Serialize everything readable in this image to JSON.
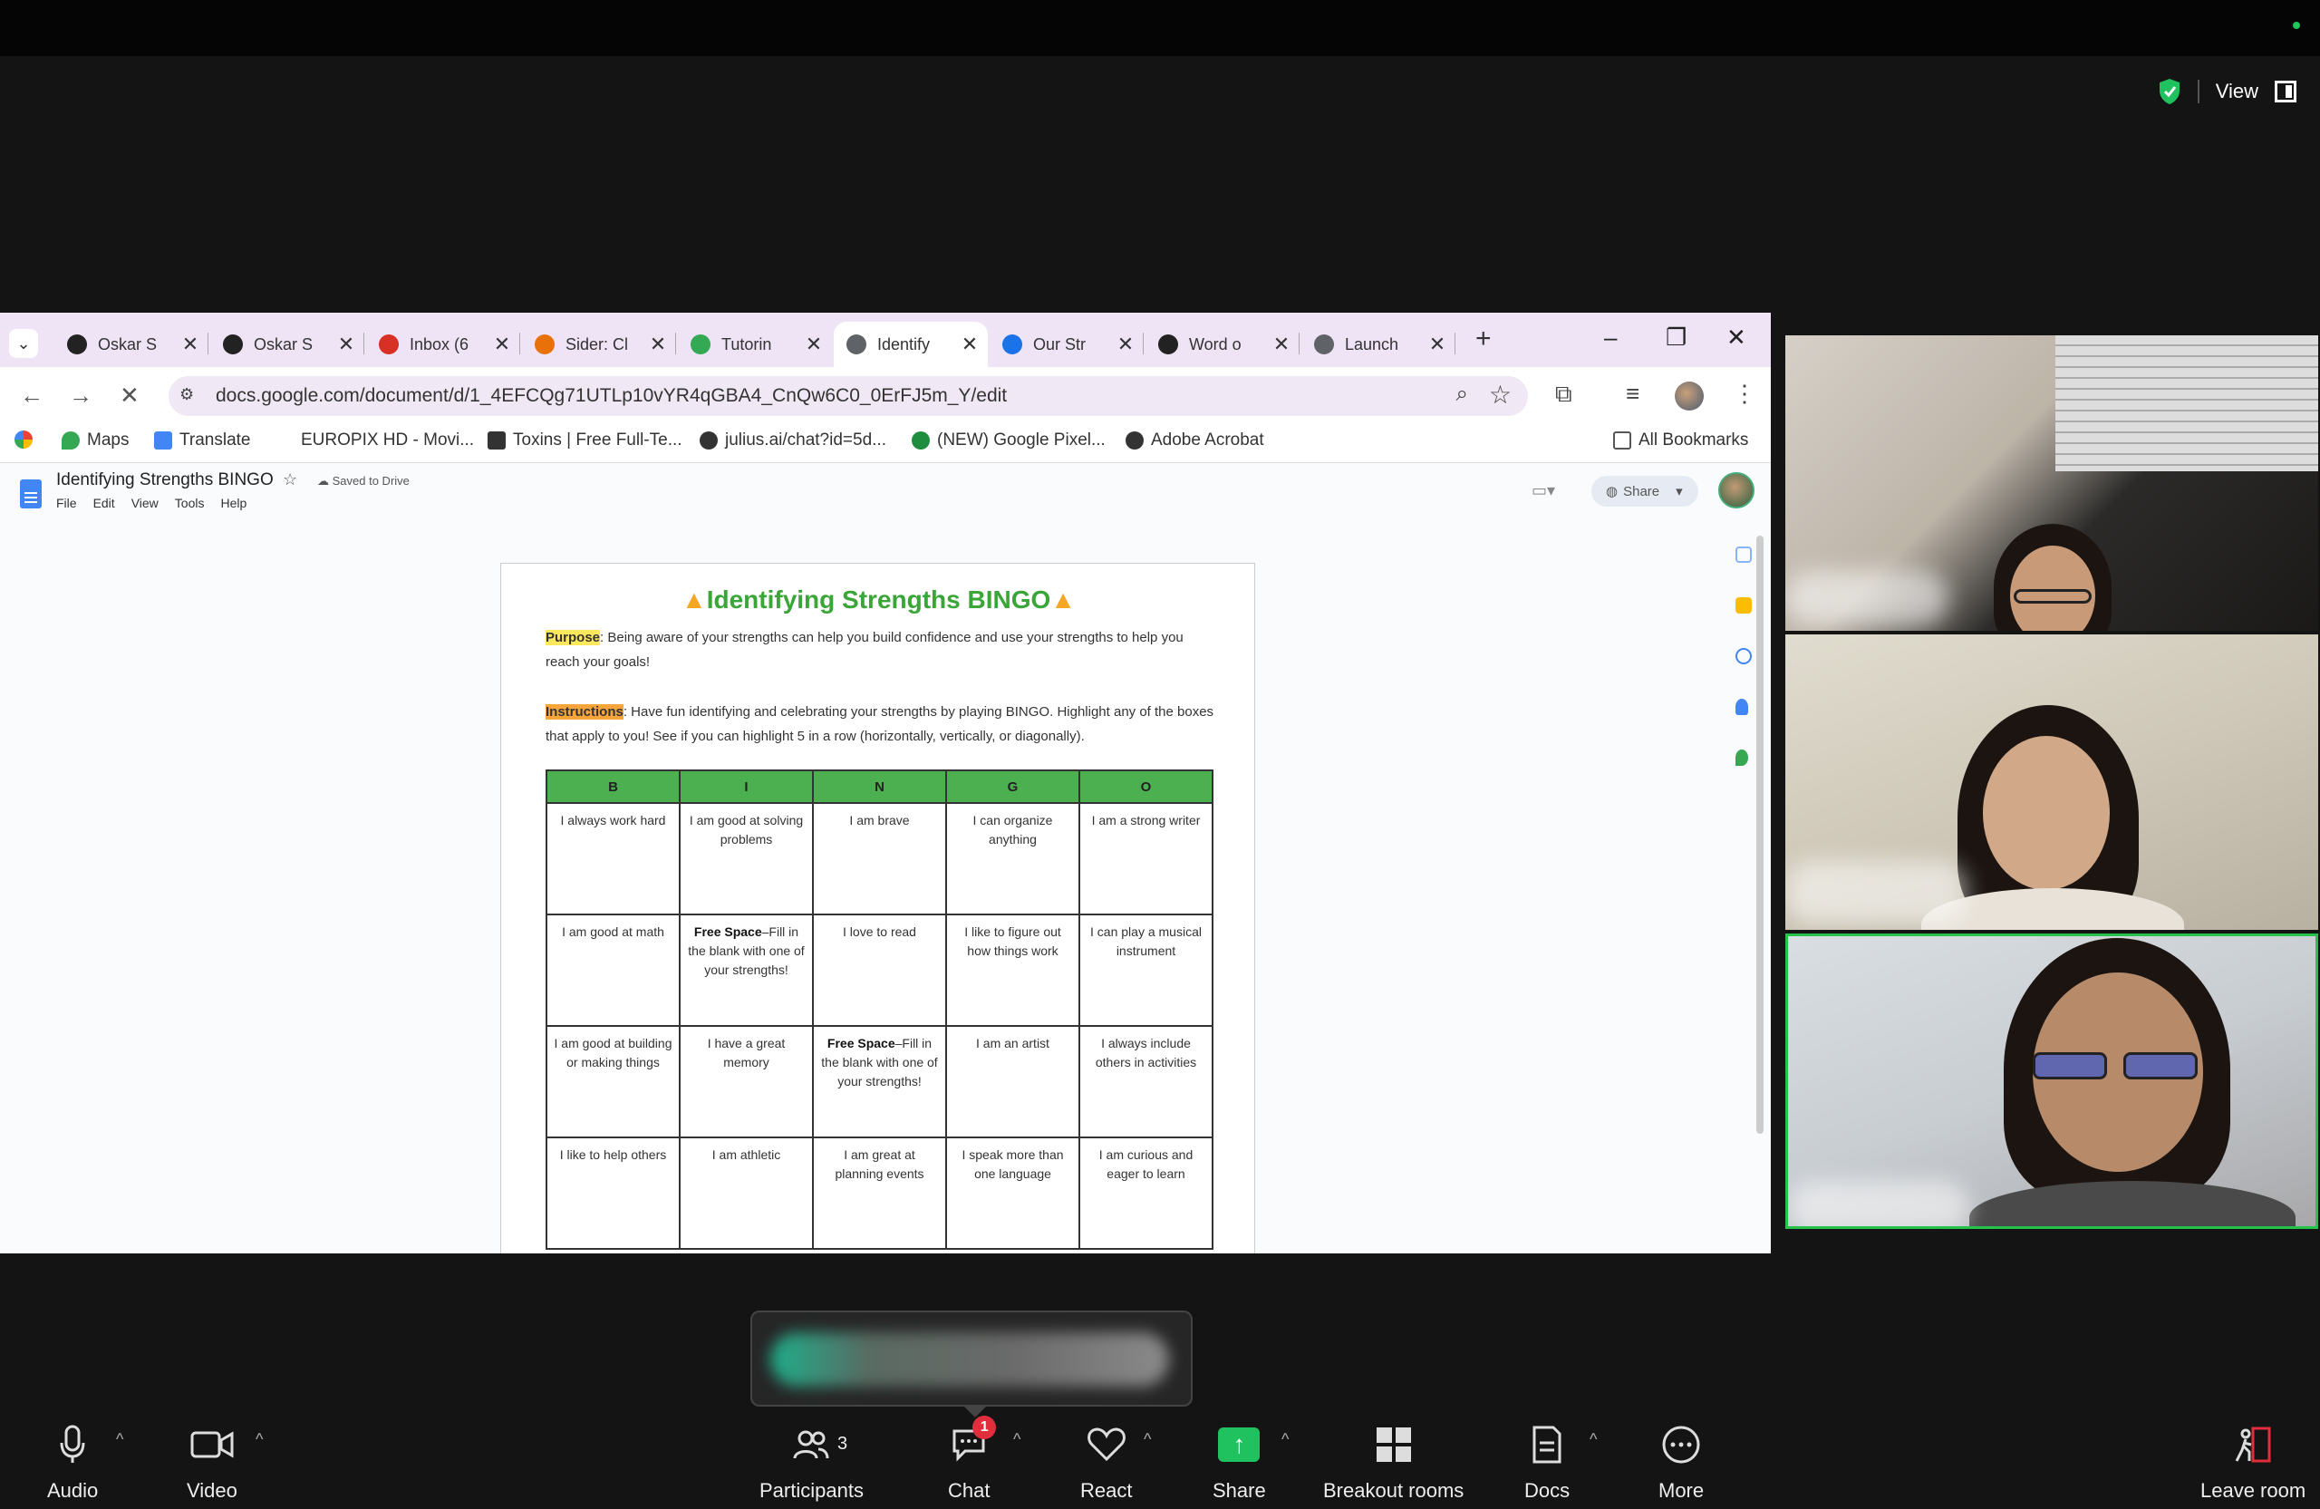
{
  "zoom": {
    "view_label": "View",
    "participants_count": "3",
    "chat_badge": "1",
    "toolbar": {
      "audio": "Audio",
      "video": "Video",
      "participants": "Participants",
      "chat": "Chat",
      "react": "React",
      "share": "Share",
      "breakout": "Breakout rooms",
      "docs": "Docs",
      "more": "More",
      "leave": "Leave room"
    }
  },
  "browser": {
    "tabs": [
      {
        "label": "Oskar S",
        "icon_color": "#222"
      },
      {
        "label": "Oskar S",
        "icon_color": "#222"
      },
      {
        "label": "Inbox (6",
        "icon_color": "#d93025"
      },
      {
        "label": "Sider: Cl",
        "icon_color": "#e8710a"
      },
      {
        "label": "Tutorin",
        "icon_color": "#34a853"
      },
      {
        "label": "Identify",
        "icon_color": "#5f6368"
      },
      {
        "label": "Our Str",
        "icon_color": "#1a73e8"
      },
      {
        "label": "Word o",
        "icon_color": "#222"
      },
      {
        "label": "Launch",
        "icon_color": "#5f6368"
      }
    ],
    "url": "docs.google.com/document/d/1_4EFCQg71UTLp10vYR4qGBA4_CnQw6C0_0ErFJ5m_Y/edit",
    "bookmarks": [
      "Maps",
      "Translate",
      "EUROPIX HD - Movi...",
      "Toxins | Free Full-Te...",
      "julius.ai/chat?id=5d...",
      "(NEW) Google Pixel...",
      "Adobe Acrobat",
      "All Bookmarks"
    ]
  },
  "docs": {
    "title": "Identifying Strengths BINGO",
    "saved": "Saved to Drive",
    "menu": [
      "File",
      "Edit",
      "View",
      "Tools",
      "Help"
    ],
    "share": "Share",
    "page": {
      "heading": "Identifying Strengths BINGO",
      "purpose_label": "Purpose",
      "purpose_text": ": Being aware of your strengths can help you build confidence and use your strengths to help you reach your goals!",
      "instructions_label": "Instructions",
      "instructions_text": ": Have fun identifying and celebrating your strengths by playing BINGO. Highlight any of the boxes that apply to you! See if you can highlight 5 in a row (horizontally, vertically, or diagonally).",
      "columns": [
        "B",
        "I",
        "N",
        "G",
        "O"
      ],
      "rows": [
        [
          "I always work hard",
          "I am good at solving problems",
          "I am brave",
          "I can organize anything",
          "I am a strong writer"
        ],
        [
          "I am good at math",
          "Free Space|–Fill in the blank with one of your strengths!",
          "I love to read",
          "I like to figure out how things work",
          "I can play a musical instrument"
        ],
        [
          "I am good at building or making things",
          "I have a great memory",
          "Free Space|–Fill in the blank with one of your strengths!",
          "I am an artist",
          "I always include others in activities"
        ],
        [
          "I like to help others",
          "I am athletic",
          "I am great at planning events",
          "I speak more than one language",
          "I am curious and eager to learn"
        ]
      ]
    }
  }
}
